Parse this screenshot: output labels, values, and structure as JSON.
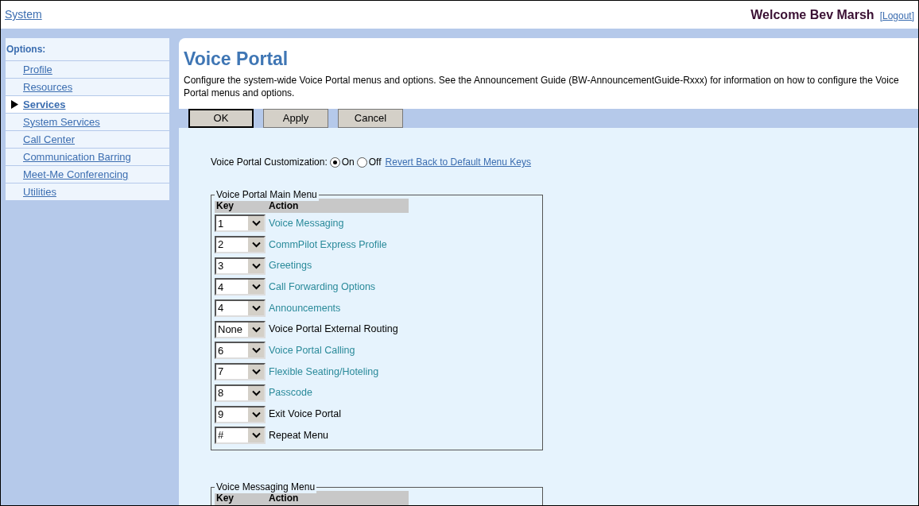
{
  "header": {
    "breadcrumb": "System",
    "welcome": "Welcome Bev Marsh",
    "logout": "[Logout]"
  },
  "sidebar": {
    "title": "Options:",
    "items": [
      {
        "label": "Profile",
        "selected": false
      },
      {
        "label": "Resources",
        "selected": false
      },
      {
        "label": "Services",
        "selected": true
      },
      {
        "label": "System Services",
        "selected": false
      },
      {
        "label": "Call Center",
        "selected": false
      },
      {
        "label": "Communication Barring",
        "selected": false
      },
      {
        "label": "Meet-Me Conferencing",
        "selected": false
      },
      {
        "label": "Utilities",
        "selected": false
      }
    ]
  },
  "page": {
    "title": "Voice Portal",
    "description": "Configure the system-wide Voice Portal menus and options. See the Announcement Guide (BW-AnnouncementGuide-Rxxx) for information on how to configure the Voice Portal menus and options."
  },
  "buttons": [
    "OK",
    "Apply",
    "Cancel"
  ],
  "customization": {
    "label": "Voice Portal Customization:",
    "options": [
      {
        "label": "On",
        "selected": true
      },
      {
        "label": "Off",
        "selected": false
      }
    ],
    "link": "Revert Back to Default Menu Keys"
  },
  "main_menu": {
    "legend": "Voice Portal Main Menu",
    "columns": [
      "Key",
      "Action"
    ],
    "rows": [
      {
        "key": "1",
        "action": "Voice Messaging",
        "kind": "service"
      },
      {
        "key": "2",
        "action": "CommPilot Express Profile",
        "kind": "service"
      },
      {
        "key": "3",
        "action": "Greetings",
        "kind": "service"
      },
      {
        "key": "4",
        "action": "Call Forwarding Options",
        "kind": "service"
      },
      {
        "key": "4",
        "action": "Announcements",
        "kind": "service"
      },
      {
        "key": "None",
        "action": "Voice Portal External Routing",
        "kind": "plain"
      },
      {
        "key": "6",
        "action": "Voice Portal Calling",
        "kind": "service"
      },
      {
        "key": "7",
        "action": "Flexible Seating/Hoteling",
        "kind": "service"
      },
      {
        "key": "8",
        "action": "Passcode",
        "kind": "service"
      },
      {
        "key": "9",
        "action": "Exit Voice Portal",
        "kind": "plain"
      },
      {
        "key": "#",
        "action": "Repeat Menu",
        "kind": "plain"
      }
    ]
  },
  "messaging_menu": {
    "legend": "Voice Messaging Menu",
    "columns": [
      "Key",
      "Action"
    ]
  }
}
